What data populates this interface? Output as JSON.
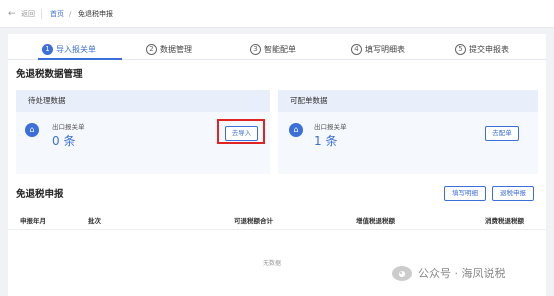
{
  "topbar": {
    "back_icon": "←",
    "back_label": "返回",
    "breadcrumb_home": "首页",
    "breadcrumb_separator": "/",
    "breadcrumb_current": "免退税申报"
  },
  "steps": [
    {
      "num": "1",
      "label": "导入报关单",
      "active": true
    },
    {
      "num": "2",
      "label": "数据管理",
      "active": false
    },
    {
      "num": "3",
      "label": "智能配单",
      "active": false
    },
    {
      "num": "4",
      "label": "填写明细表",
      "active": false
    },
    {
      "num": "5",
      "label": "提交申报表",
      "active": false
    }
  ],
  "data_section": {
    "title": "免退税数据管理",
    "pending": {
      "header": "待处理数据",
      "sub_label": "出口报关单",
      "count": "0 条",
      "button": "去导入"
    },
    "matchable": {
      "header": "可配单数据",
      "sub_label": "出口报关单",
      "count": "1 条",
      "button": "去配单"
    }
  },
  "declare_section": {
    "title": "免退税申报",
    "fill_button": "填写明细",
    "submit_button": "退税申报",
    "columns": [
      "申报年月",
      "批次",
      "可退税额合计",
      "增值税退税额",
      "消费税退税额"
    ],
    "empty_text": "无数据"
  },
  "watermark": {
    "text": "公众号 · 海凤说税"
  },
  "colors": {
    "accent": "#3d6fd8",
    "highlight": "#e02424"
  }
}
